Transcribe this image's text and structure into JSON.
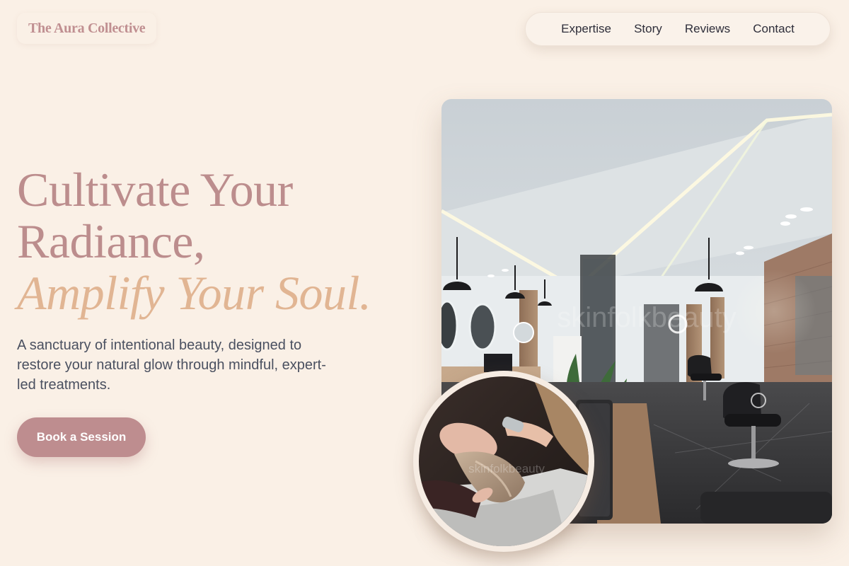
{
  "brand": {
    "name": "The Aura Collective"
  },
  "nav": {
    "items": [
      {
        "label": "Expertise"
      },
      {
        "label": "Story"
      },
      {
        "label": "Reviews"
      },
      {
        "label": "Contact"
      }
    ]
  },
  "hero": {
    "headline_line1": "Cultivate Your",
    "headline_line2": "Radiance,",
    "headline_accent": "Amplify Your Soul.",
    "description": "A sanctuary of intentional beauty, designed to restore your natural glow through mindful, expert-led treatments.",
    "cta_label": "Book a Session"
  },
  "media": {
    "main_photo_watermark": "skinfolkbeauty",
    "inset_photo_watermark": "skinfolkbeauty"
  },
  "colors": {
    "background": "#FAF0E6",
    "brand_rose": "#BC8D8D",
    "accent_peach": "#E1B593",
    "body_text": "#4A5060",
    "button": "#BE8D8F"
  }
}
